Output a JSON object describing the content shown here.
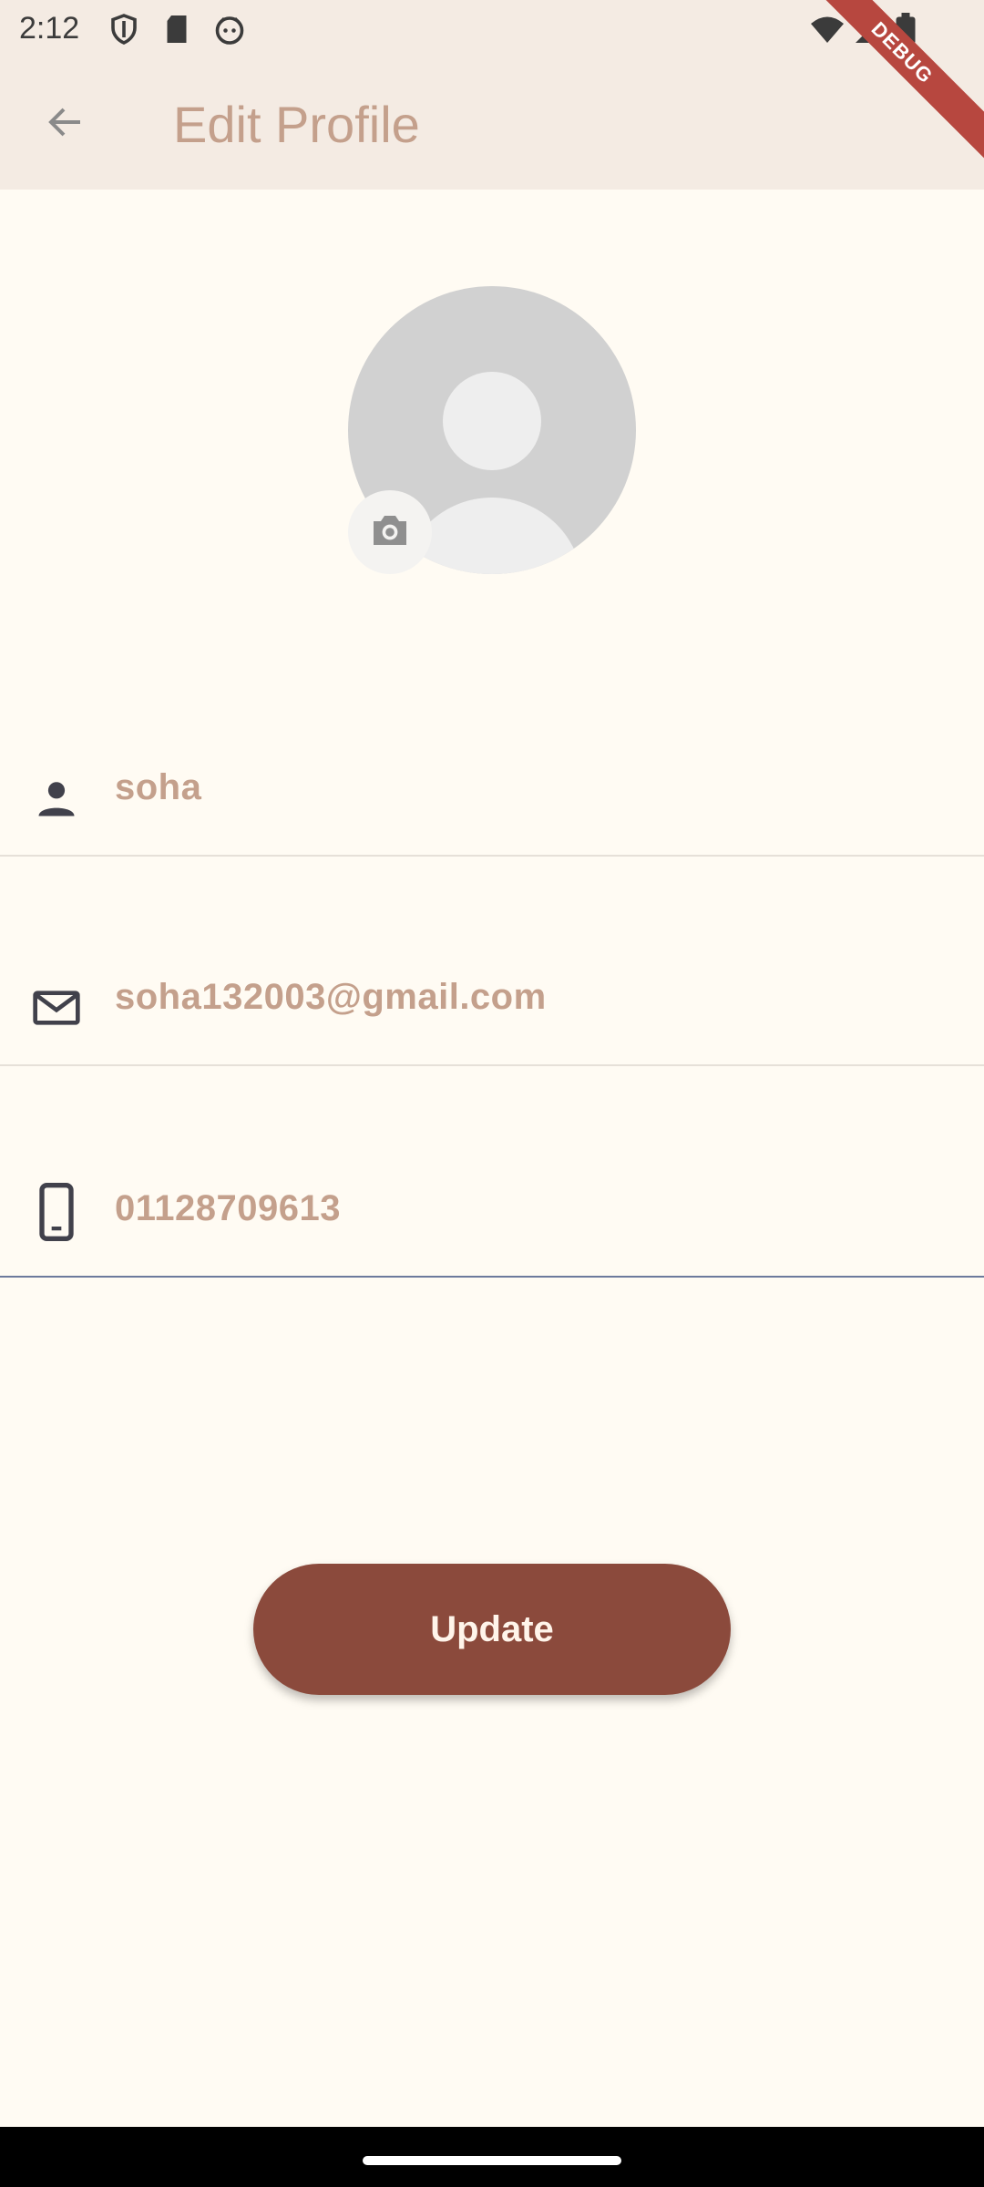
{
  "status_bar": {
    "time": "2:12",
    "icons": [
      "shield-icon",
      "sd-card-icon",
      "android-face-icon",
      "wifi-icon",
      "signal-icon",
      "battery-icon"
    ]
  },
  "app_bar": {
    "title": "Edit Profile",
    "back_icon": "arrow-back-icon",
    "debug_label": "DEBUG"
  },
  "avatar": {
    "placeholder_icon": "person-placeholder",
    "camera_icon": "camera-icon"
  },
  "fields": {
    "name": {
      "icon": "person-icon",
      "value": "soha"
    },
    "email": {
      "icon": "mail-icon",
      "value": "soha132003@gmail.com"
    },
    "phone": {
      "icon": "smartphone-icon",
      "value": "01128709613"
    }
  },
  "update_button": {
    "label": "Update"
  },
  "colors": {
    "background": "#fffbf3",
    "app_bar": "#f4ebe3",
    "accent_text": "#c4a08c",
    "button": "#8b4a3c",
    "debug_banner": "#b7473f"
  }
}
